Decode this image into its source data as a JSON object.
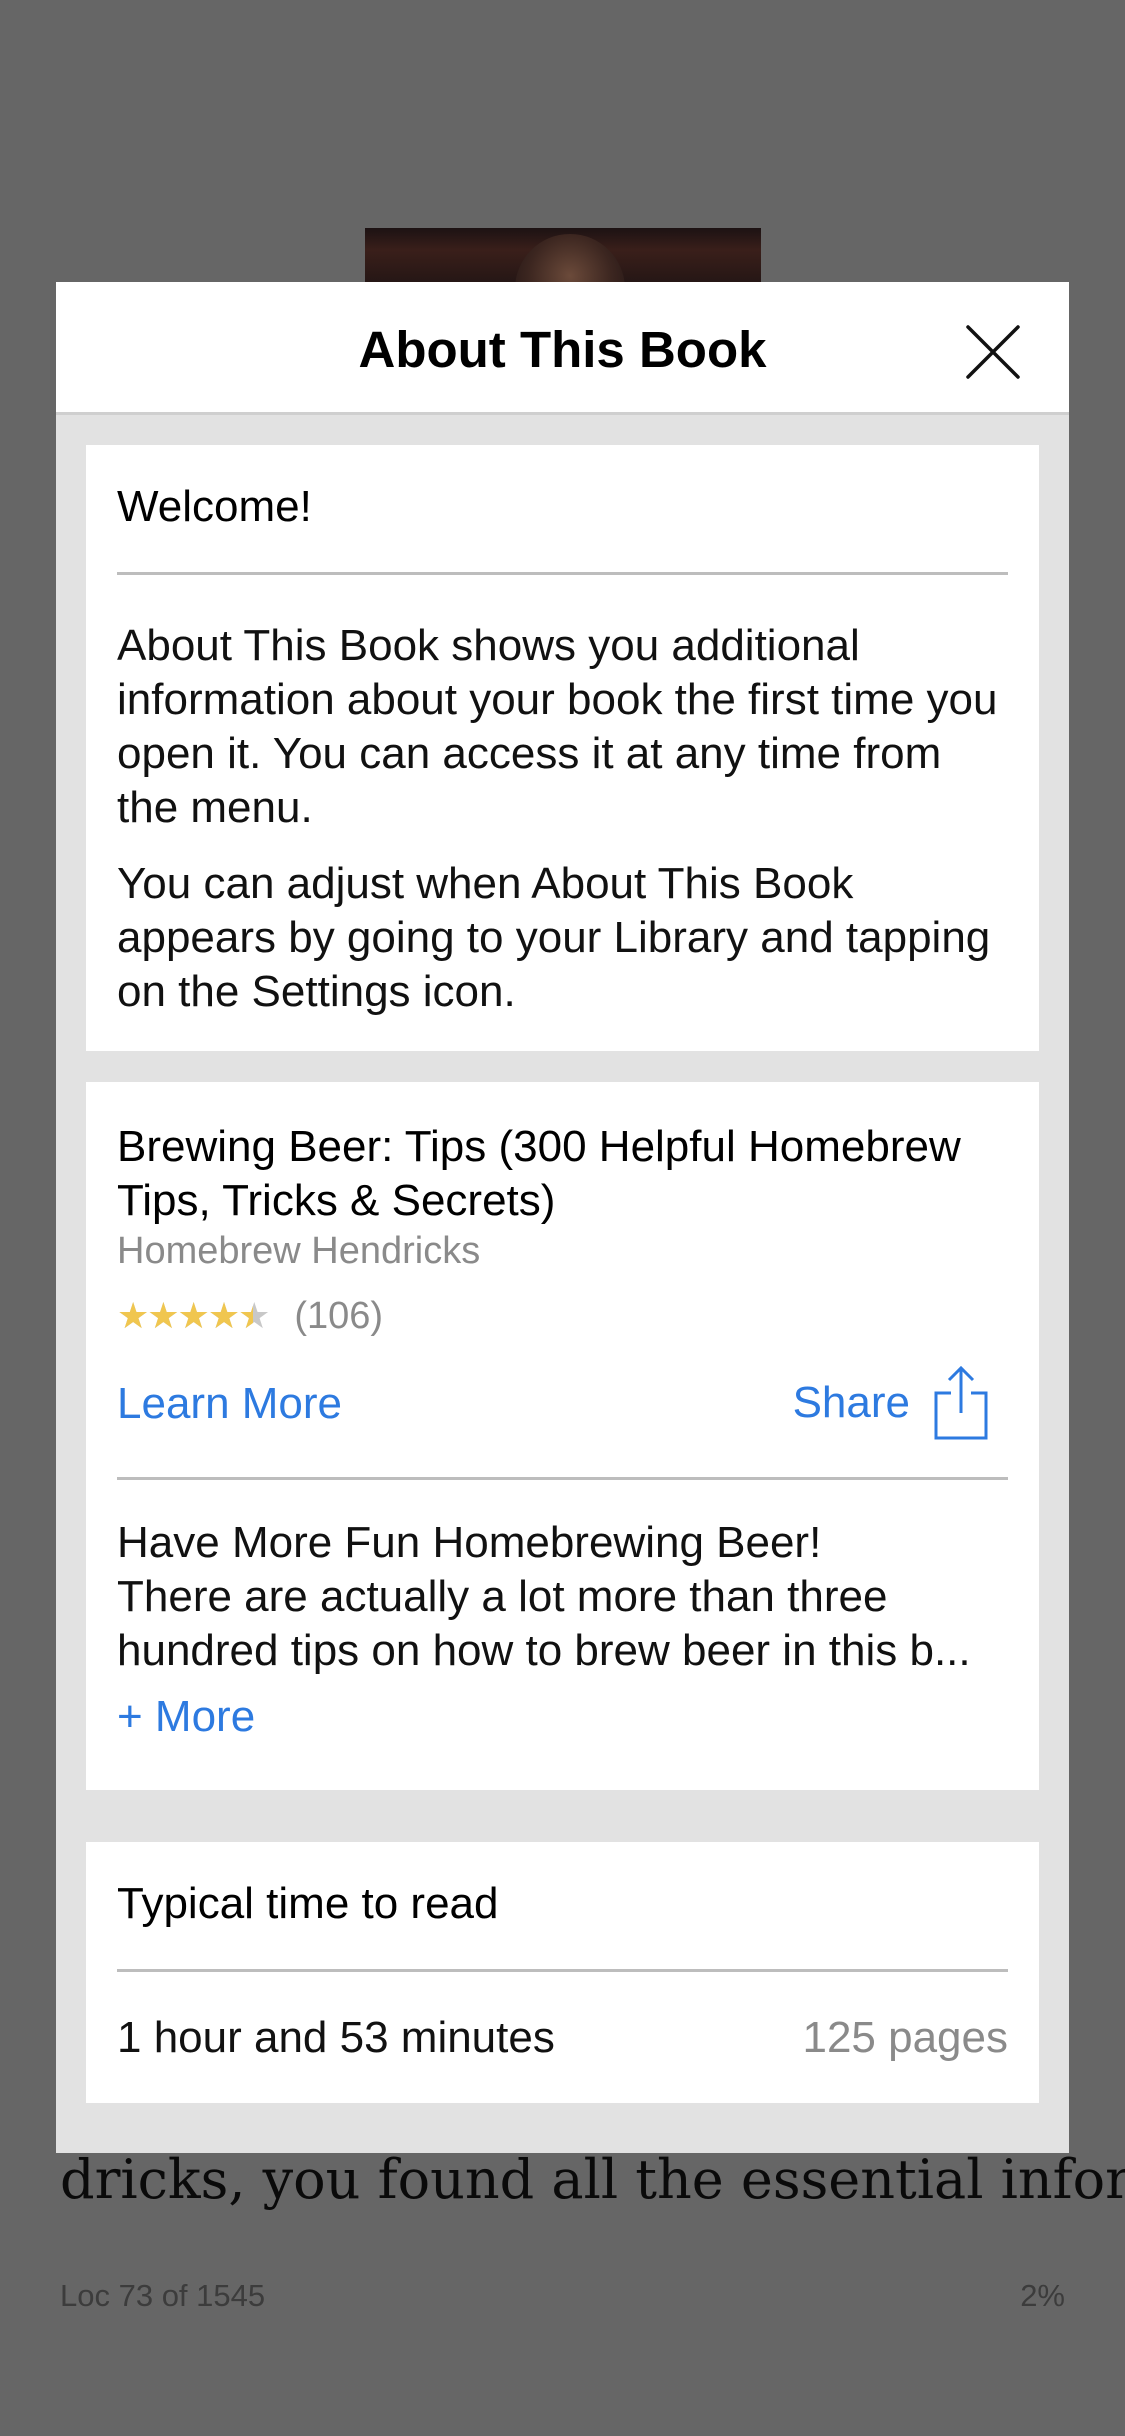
{
  "background": {
    "reading_text": "dricks, you found all the essential infor-",
    "location": "Loc 73 of 1545",
    "progress_percent": "2%"
  },
  "modal": {
    "title": "About This Book",
    "close_icon": "close-icon",
    "welcome": {
      "title": "Welcome!",
      "paragraph1": "About This Book shows you additional information about your book the first time you open it. You can access it at any time from the menu.",
      "paragraph2": "You can adjust when About This Book appears by going to your Library and tapping on the Settings icon."
    },
    "book": {
      "title": "Brewing Beer: Tips (300 Helpful Homebrew Tips, Tricks & Secrets)",
      "author": "Homebrew Hendricks",
      "rating_stars": 4.5,
      "rating_max": 5,
      "rating_count": "(106)",
      "learn_more_label": "Learn More",
      "share_label": "Share",
      "share_icon": "share-icon",
      "description_line1": "Have More Fun Homebrewing Beer!",
      "description_line2": "There are actually a lot more than three hundred tips on how to brew beer in this b...",
      "more_label": "+ More"
    },
    "reading_time": {
      "title": "Typical time to read",
      "duration": "1 hour and 53 minutes",
      "pages": "125 pages"
    }
  },
  "colors": {
    "overlay": "#666666",
    "link_blue": "#2d7ae0",
    "star_gold": "#f0c64f",
    "secondary_text": "#8a8a8a"
  }
}
